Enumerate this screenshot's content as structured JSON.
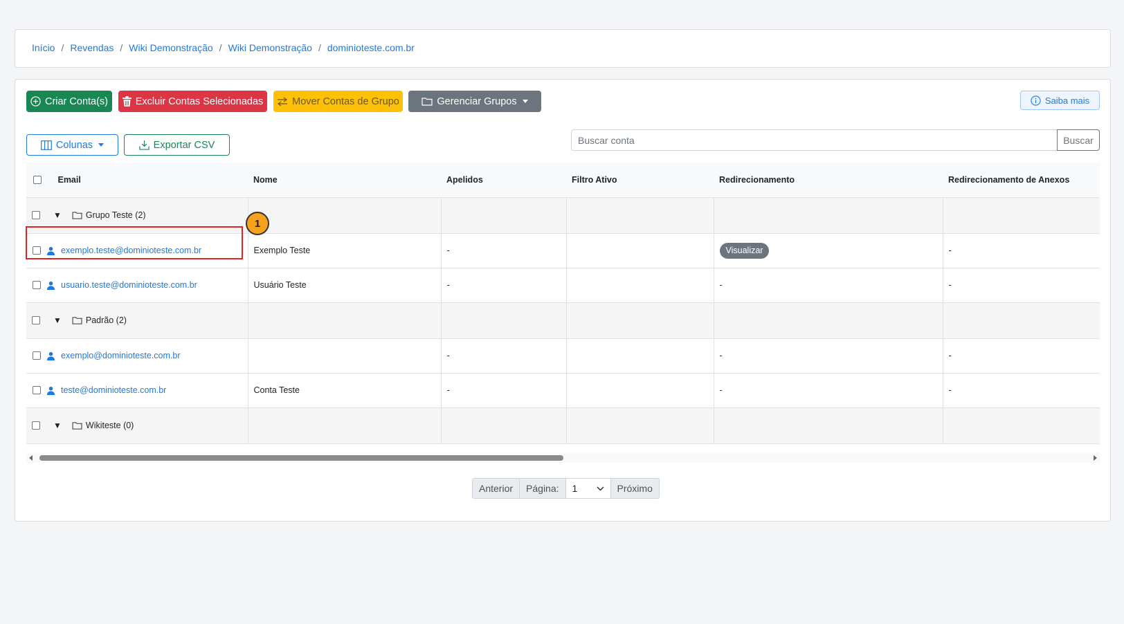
{
  "breadcrumb": [
    "Início",
    "Revendas",
    "Wiki Demonstração",
    "Wiki Demonstração",
    "dominioteste.com.br"
  ],
  "toolbar": {
    "create_label": "Criar Conta(s)",
    "delete_label": "Excluir Contas Selecionadas",
    "move_label": "Mover Contas de Grupo",
    "groups_label": "Gerenciar Grupos",
    "info_label": "Saiba mais",
    "columns_label": "Colunas",
    "export_label": "Exportar CSV"
  },
  "search": {
    "placeholder": "Buscar conta",
    "button": "Buscar"
  },
  "table": {
    "headers": [
      "Email",
      "Nome",
      "Apelidos",
      "Filtro Ativo",
      "Redirecionamento",
      "Redirecionamento de Anexos"
    ],
    "rows": [
      {
        "type": "group",
        "name": "Grupo Teste (2)"
      },
      {
        "type": "account",
        "email": "exemplo.teste@dominioteste.com.br",
        "nome": "Exemplo Teste",
        "apelidos": "-",
        "filtro": "",
        "redirect": "Visualizar",
        "redirect_anexos": "-"
      },
      {
        "type": "account",
        "email": "usuario.teste@dominioteste.com.br",
        "nome": "Usuário Teste",
        "apelidos": "-",
        "filtro": "",
        "redirect": "-",
        "redirect_anexos": "-"
      },
      {
        "type": "group",
        "name": "Padrão (2)"
      },
      {
        "type": "account",
        "email": "exemplo@dominioteste.com.br",
        "nome": "",
        "apelidos": "-",
        "filtro": "",
        "redirect": "-",
        "redirect_anexos": "-"
      },
      {
        "type": "account",
        "email": "teste@dominioteste.com.br",
        "nome": "Conta Teste",
        "apelidos": "-",
        "filtro": "",
        "redirect": "-",
        "redirect_anexos": "-"
      },
      {
        "type": "group",
        "name": "Wikiteste (0)"
      }
    ]
  },
  "step_marker": "1",
  "pagination": {
    "prev": "Anterior",
    "label": "Página:",
    "page": "1",
    "next": "Próximo"
  },
  "colors": {
    "primary": "#1f7ae0",
    "success": "#198754",
    "danger": "#dc3545",
    "warning": "#ffc107",
    "secondary": "#6c757d",
    "highlight": "#e02424",
    "marker": "#f6a21a"
  }
}
